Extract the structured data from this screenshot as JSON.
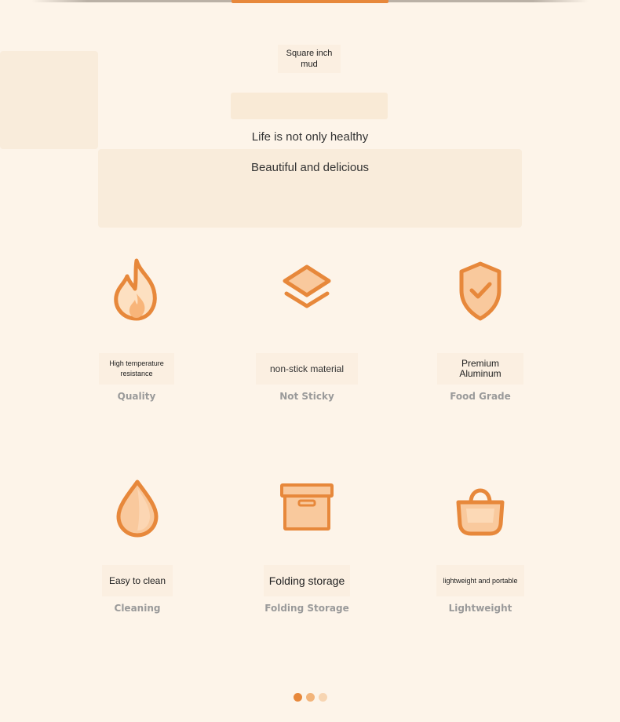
{
  "header": {
    "unit_label": "Square inch\nmud"
  },
  "taglines": {
    "line1": "Life is not only healthy",
    "line2": "Beautiful and delicious"
  },
  "features": [
    {
      "label": "High temperature resistance",
      "sub": "Quality",
      "icon": "flame-icon"
    },
    {
      "label": "non-stick material",
      "sub": "Not Sticky",
      "icon": "layers-icon"
    },
    {
      "label": "Premium Aluminum",
      "sub": "Food Grade",
      "icon": "shield-check-icon"
    },
    {
      "label": "Easy to clean",
      "sub": "Cleaning",
      "icon": "water-drop-icon"
    },
    {
      "label": "Folding storage",
      "sub": "Folding Storage",
      "icon": "storage-box-icon"
    },
    {
      "label": "lightweight and portable",
      "sub": "Lightweight",
      "icon": "handbag-icon"
    }
  ],
  "colors": {
    "background": "#fdf4e9",
    "accent": "#e7883b",
    "accent_light": "#f9c99d",
    "subtitle": "#9a9a9a"
  },
  "pagination": {
    "count": 3,
    "active_index": 0
  }
}
